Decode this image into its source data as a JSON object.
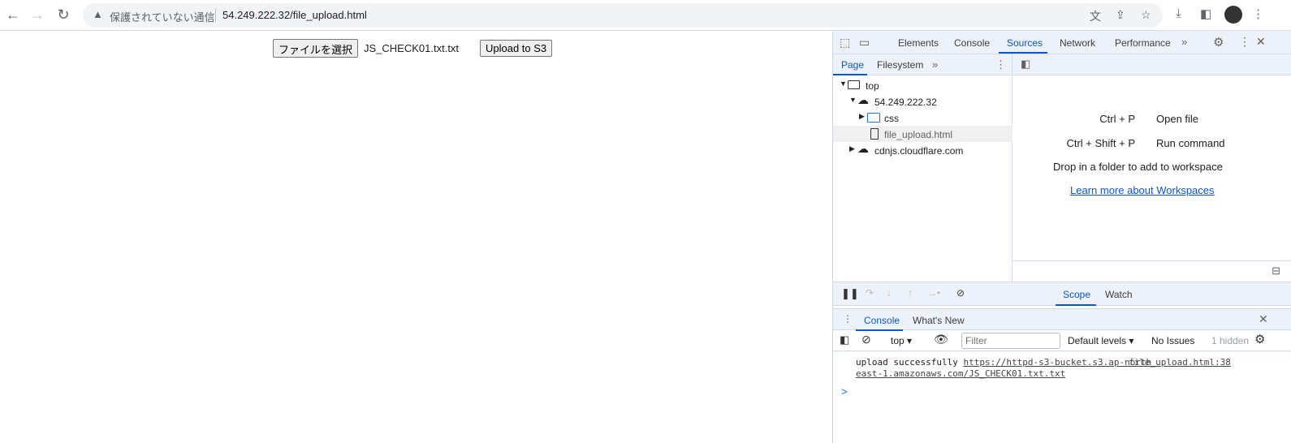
{
  "browser": {
    "security_label": "保護されていない通信",
    "url": "54.249.222.32/file_upload.html"
  },
  "page": {
    "choose_file_label": "ファイルを選択",
    "file_name": "JS_CHECK01.txt.txt",
    "upload_label": "Upload to S3"
  },
  "devtools": {
    "tabs": [
      "Elements",
      "Console",
      "Sources",
      "Network",
      "Performance"
    ],
    "active_tab": "Sources",
    "navigator_tabs": [
      "Page",
      "Filesystem"
    ],
    "tree": {
      "top": "top",
      "host": "54.249.222.32",
      "folder": "css",
      "file": "file_upload.html",
      "cdn": "cdnjs.cloudflare.com"
    },
    "shortcuts": [
      {
        "keys": "Ctrl + P",
        "action": "Open file"
      },
      {
        "keys": "Ctrl + Shift + P",
        "action": "Run command"
      }
    ],
    "drop_text": "Drop in a folder to add to workspace",
    "learn_link": "Learn more about Workspaces",
    "side_tabs": [
      "Scope",
      "Watch"
    ],
    "drawer_tabs": [
      "Console",
      "What's New"
    ],
    "console_toolbar": {
      "context": "top",
      "filter_placeholder": "Filter",
      "levels": "Default levels",
      "issues": "No Issues",
      "hidden": "1 hidden"
    },
    "message": {
      "text": "upload successfully ",
      "link1": "https://httpd-s3-bucket.s3.ap-north",
      "link2": "east-1.amazonaws.com/JS_CHECK01.txt.txt",
      "source": "file_upload.html:38"
    },
    "prompt": ">"
  }
}
